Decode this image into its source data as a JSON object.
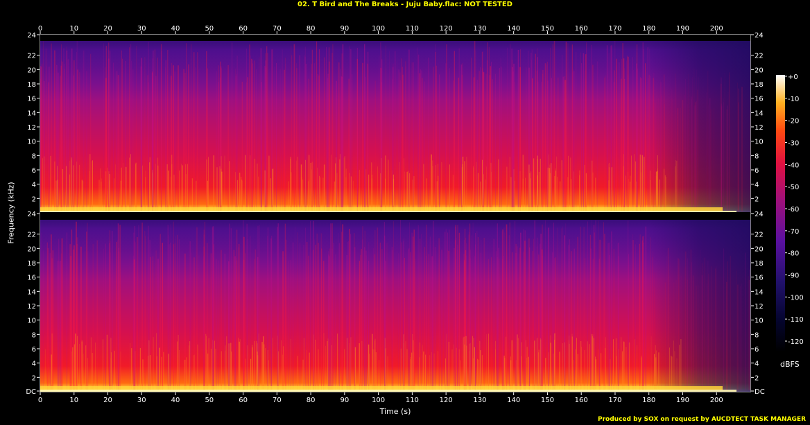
{
  "title": "02. T Bird and The Breaks - Juju Baby.flac: NOT TESTED",
  "footer": "Produced by SOX on request by AUCDTECT TASK MANAGER",
  "colors": {
    "title": "#ffff00",
    "background": "#000000"
  },
  "chart_data": {
    "type": "heatmap",
    "xlabel": "Time (s)",
    "ylabel": "Frequency (kHz)",
    "xlim": [
      0,
      210
    ],
    "ylim": [
      0,
      24
    ],
    "x_ticks": [
      "0",
      "10",
      "20",
      "30",
      "40",
      "50",
      "60",
      "70",
      "80",
      "90",
      "100",
      "110",
      "120",
      "130",
      "140",
      "150",
      "160",
      "170",
      "180",
      "190",
      "200"
    ],
    "y_ticks_left_top": [
      "2",
      "4",
      "6",
      "8",
      "10",
      "12",
      "14",
      "16",
      "18",
      "20",
      "22",
      "24"
    ],
    "y_ticks_left_bottom": [
      "DC",
      "2",
      "4",
      "6",
      "8",
      "10",
      "12",
      "14",
      "16",
      "18",
      "20",
      "22",
      "24"
    ],
    "y_ticks_right_top": [
      "2",
      "4",
      "6",
      "8",
      "10",
      "12",
      "14",
      "16",
      "18",
      "20",
      "22",
      "24"
    ],
    "y_ticks_right_bottom": [
      "DC",
      "2",
      "4",
      "6",
      "8",
      "10",
      "12",
      "14",
      "16",
      "18",
      "20",
      "22",
      "24"
    ],
    "colorbar": {
      "unit": "dBFS",
      "ticks": [
        "+0",
        "-10",
        "-20",
        "-30",
        "-40",
        "-50",
        "-60",
        "-70",
        "-80",
        "-90",
        "-100",
        "-110",
        "-120"
      ],
      "range": [
        -120,
        0
      ]
    },
    "channels": 2,
    "bandwidth_khz": 22.9,
    "signal_end_s": 209
  }
}
